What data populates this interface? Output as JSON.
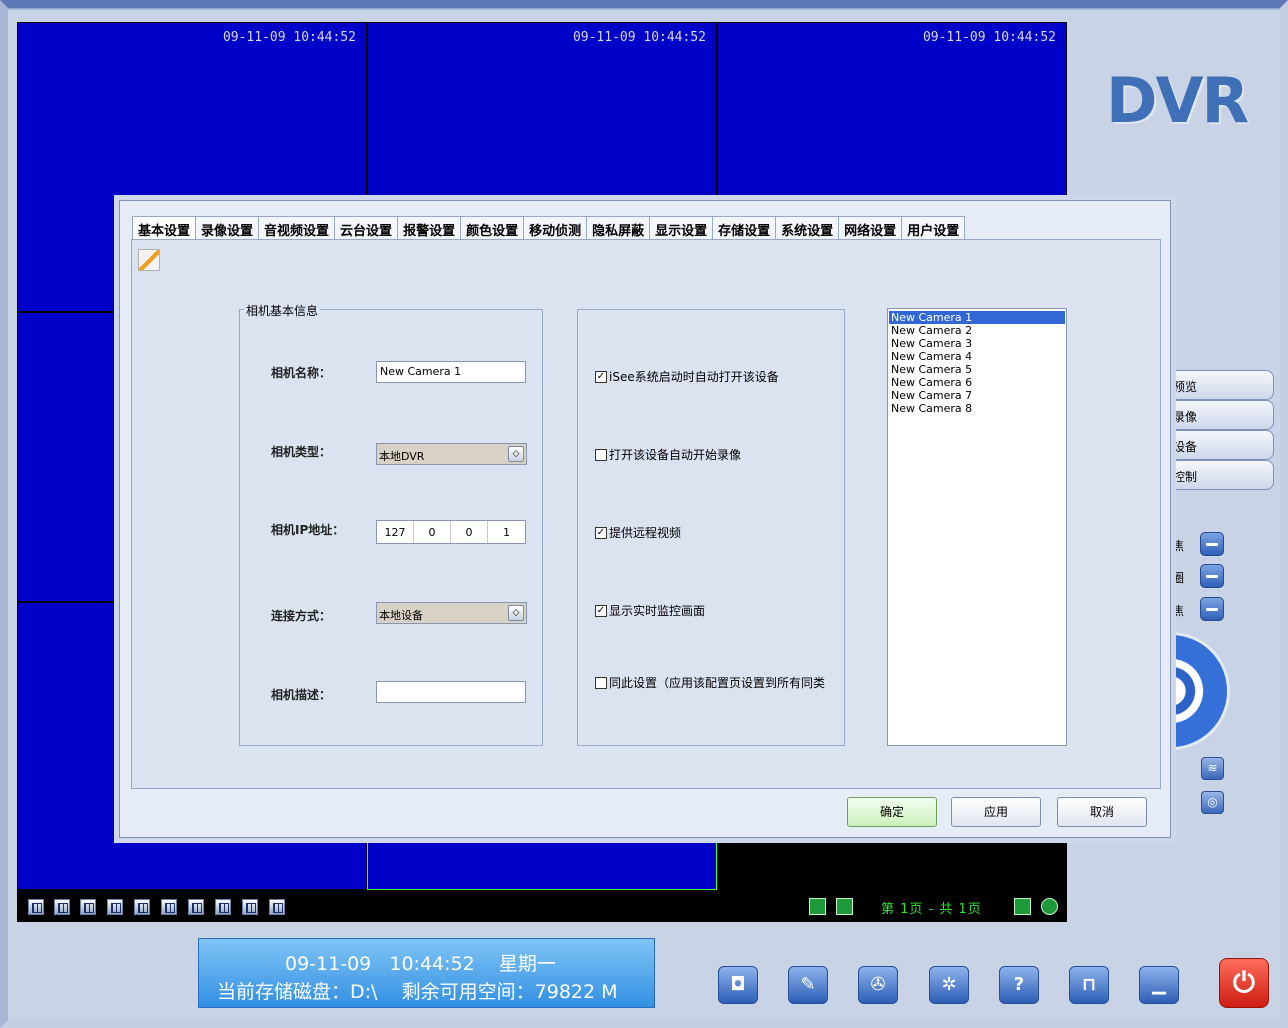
{
  "video": {
    "timestamp": "09-11-09 10:44:52"
  },
  "grid_toolbar": {
    "page_text": "第 1页 - 共 1页"
  },
  "logo": "DVR",
  "side_menu": {
    "items": [
      "预览",
      "录像",
      "设备",
      "控制"
    ],
    "labels": [
      "焦",
      "圈",
      "焦"
    ]
  },
  "dialog": {
    "tabs": [
      "基本设置",
      "录像设置",
      "音视频设置",
      "云台设置",
      "报警设置",
      "颜色设置",
      "移动侦测",
      "隐私屏蔽",
      "显示设置",
      "存储设置",
      "系统设置",
      "网络设置",
      "用户设置"
    ],
    "group_title": "相机基本信息",
    "camera_name_label": "相机名称：",
    "camera_name_value": "New Camera 1",
    "camera_type_label": "相机类型：",
    "camera_type_value": "本地DVR",
    "camera_ip_label": "相机IP地址：",
    "ip": [
      "127",
      "0",
      "0",
      "1"
    ],
    "connect_label": "连接方式：",
    "connect_value": "本地设备",
    "desc_label": "相机描述：",
    "desc_value": "",
    "checks": [
      {
        "label": "iSee系统启动时自动打开该设备",
        "checked": true
      },
      {
        "label": "打开该设备自动开始录像",
        "checked": false
      },
      {
        "label": "提供远程视频",
        "checked": true
      },
      {
        "label": "显示实时监控画面",
        "checked": true
      },
      {
        "label": "同此设置（应用该配置页设置到所有同类",
        "checked": false
      }
    ],
    "camera_list": [
      "New Camera 1",
      "New Camera 2",
      "New Camera 3",
      "New Camera 4",
      "New Camera 5",
      "New Camera 6",
      "New Camera 7",
      "New Camera 8"
    ],
    "ok": "确定",
    "apply": "应用",
    "cancel": "取消"
  },
  "status": {
    "date": "09-11-09",
    "time": "10:44:52",
    "weekday": "星期一",
    "disk_label": "当前存储磁盘：",
    "disk": "D:\\",
    "space_label": "剩余可用空间：",
    "space": "79822 M"
  }
}
